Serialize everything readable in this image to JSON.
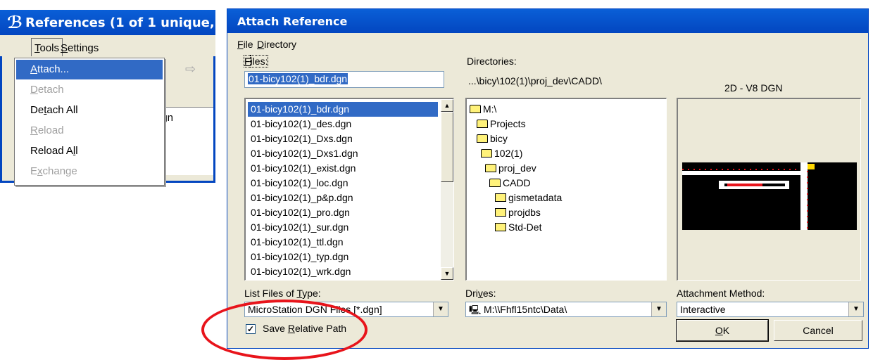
{
  "references_window": {
    "title": "References (1 of 1 unique,",
    "menu": [
      "Tools",
      "Settings"
    ],
    "list_fragment": "dgn",
    "tools_menu": [
      {
        "label": "Attach...",
        "state": "selected"
      },
      {
        "label": "Detach",
        "state": "disabled"
      },
      {
        "label": "Detach All",
        "state": "enabled"
      },
      {
        "label": "Reload",
        "state": "disabled"
      },
      {
        "label": "Reload All",
        "state": "enabled"
      },
      {
        "label": "Exchange",
        "state": "disabled"
      }
    ]
  },
  "dialog": {
    "title": "Attach Reference",
    "menu": [
      "File",
      "Directory"
    ],
    "files_label": "Files:",
    "file_name": "01-bicy102(1)_bdr.dgn",
    "directories_label": "Directories:",
    "current_dir": "...\\bicy\\102(1)\\proj_dev\\CADD\\",
    "preview_type": "2D - V8 DGN",
    "files": [
      "01-bicy102(1)_bdr.dgn",
      "01-bicy102(1)_des.dgn",
      "01-bicy102(1)_Dxs.dgn",
      "01-bicy102(1)_Dxs1.dgn",
      "01-bicy102(1)_exist.dgn",
      "01-bicy102(1)_loc.dgn",
      "01-bicy102(1)_p&p.dgn",
      "01-bicy102(1)_pro.dgn",
      "01-bicy102(1)_sur.dgn",
      "01-bicy102(1)_ttl.dgn",
      "01-bicy102(1)_typ.dgn",
      "01-bicy102(1)_wrk.dgn"
    ],
    "directories": [
      {
        "label": "M:\\",
        "icon": "open"
      },
      {
        "label": "Projects",
        "icon": "open"
      },
      {
        "label": "bicy",
        "icon": "open"
      },
      {
        "label": "102(1)",
        "icon": "open"
      },
      {
        "label": "proj_dev",
        "icon": "open"
      },
      {
        "label": "CADD",
        "icon": "open"
      },
      {
        "label": "gismetadata",
        "icon": "closed"
      },
      {
        "label": "projdbs",
        "icon": "closed"
      },
      {
        "label": "Std-Det",
        "icon": "closed"
      }
    ],
    "list_type_label": "List Files of Type:",
    "list_type_value": "MicroStation DGN Files [*.dgn]",
    "drives_label": "Drives:",
    "drive_value": "M:\\\\Fhfl15ntc\\Data\\",
    "attach_method_label": "Attachment Method:",
    "attach_method_value": "Interactive",
    "save_relative_label": "Save Relative Path",
    "save_relative_checked": true,
    "ok_label": "OK",
    "cancel_label": "Cancel",
    "highlight_color": "#e8141b"
  }
}
